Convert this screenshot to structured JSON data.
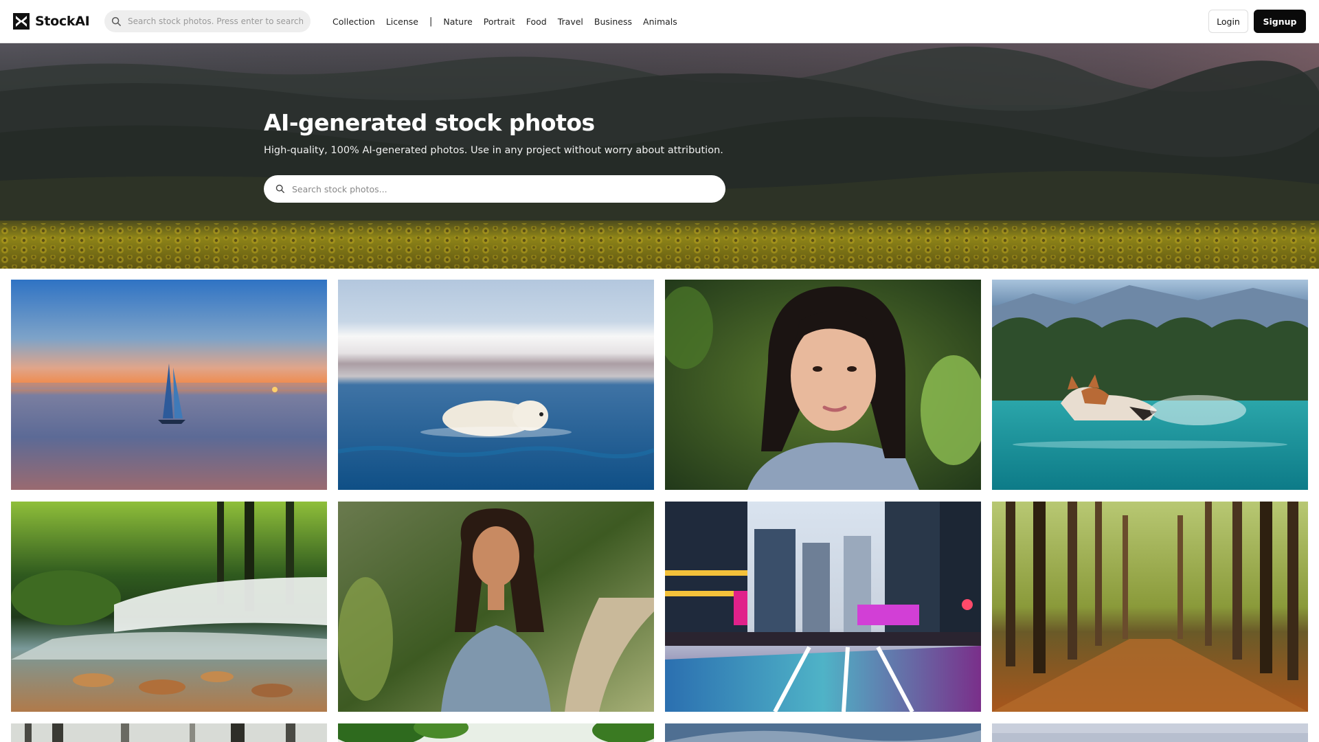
{
  "header": {
    "brand": "StockAI",
    "search_placeholder": "Search stock photos. Press enter to search.",
    "nav": {
      "collection": "Collection",
      "license": "License",
      "separator": "|",
      "nature": "Nature",
      "portrait": "Portrait",
      "food": "Food",
      "travel": "Travel",
      "business": "Business",
      "animals": "Animals"
    },
    "login_label": "Login",
    "signup_label": "Signup"
  },
  "hero": {
    "title": "AI-generated stock photos",
    "subtitle": "High-quality, 100% AI-generated photos. Use in any project without worry about attribution.",
    "search_placeholder": "Search stock photos..."
  },
  "icons": {
    "brand": "stockai-logo-icon",
    "search": "search-icon"
  },
  "colors": {
    "signup_bg": "#0a0a0a",
    "search_bg": "#eeeeee"
  }
}
